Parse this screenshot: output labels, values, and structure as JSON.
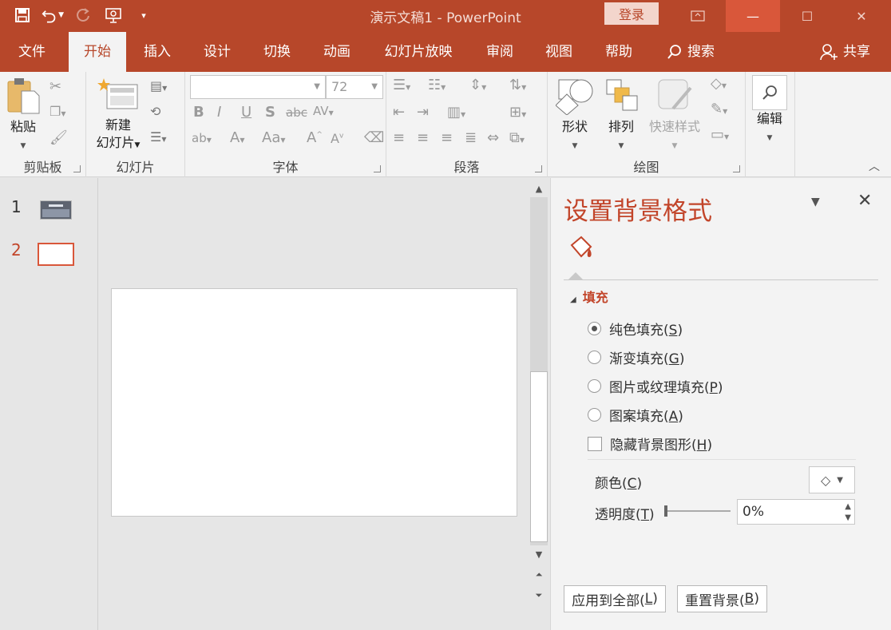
{
  "titlebar": {
    "title": "演示文稿1  -  PowerPoint",
    "login_label": "登录",
    "minimize_glyph": "—",
    "restore_glyph": "☐",
    "close_glyph": "✕"
  },
  "tabs": [
    {
      "label": "文件"
    },
    {
      "label": "开始",
      "active": true
    },
    {
      "label": "插入"
    },
    {
      "label": "设计"
    },
    {
      "label": "切换"
    },
    {
      "label": "动画"
    },
    {
      "label": "幻灯片放映"
    },
    {
      "label": "审阅"
    },
    {
      "label": "视图"
    },
    {
      "label": "帮助"
    },
    {
      "label": "搜索"
    }
  ],
  "share_label": "共享",
  "ribbon": {
    "clipboard": {
      "paste_label": "粘贴",
      "group_label": "剪贴板"
    },
    "slides": {
      "new_slide_line1": "新建",
      "new_slide_line2": "幻灯片",
      "group_label": "幻灯片"
    },
    "font": {
      "font_size": "72",
      "group_label": "字体"
    },
    "paragraph": {
      "group_label": "段落"
    },
    "drawing": {
      "shape_label": "形状",
      "arrange_label": "排列",
      "quick_style_label": "快速样式",
      "group_label": "绘图"
    },
    "editing": {
      "edit_label": "编辑"
    }
  },
  "thumbnails": [
    {
      "number": "1"
    },
    {
      "number": "2",
      "selected": true
    }
  ],
  "pane": {
    "title": "设置背景格式",
    "section_label": "填充",
    "options": [
      {
        "text": "纯色填充(",
        "key": "S",
        "end": ")",
        "selected": true
      },
      {
        "text": "渐变填充(",
        "key": "G",
        "end": ")"
      },
      {
        "text": "图片或纹理填充(",
        "key": "P",
        "end": ")"
      },
      {
        "text": "图案填充(",
        "key": "A",
        "end": ")"
      }
    ],
    "hide_graphics": {
      "text": "隐藏背景图形(",
      "key": "H",
      "end": ")"
    },
    "color_label": {
      "text": "颜色(",
      "key": "C",
      "end": ")"
    },
    "transparency_label": {
      "text": "透明度(",
      "key": "T",
      "end": ")"
    },
    "transparency_value": "0%",
    "transparency_level": 0,
    "apply_all": {
      "text": "应用到全部(",
      "key": "L",
      "end": ")"
    },
    "reset": {
      "text": "重置背景(",
      "key": "B",
      "end": ")"
    }
  },
  "colors": {
    "accent": "#b7472a",
    "pane_title": "#c2452a"
  }
}
